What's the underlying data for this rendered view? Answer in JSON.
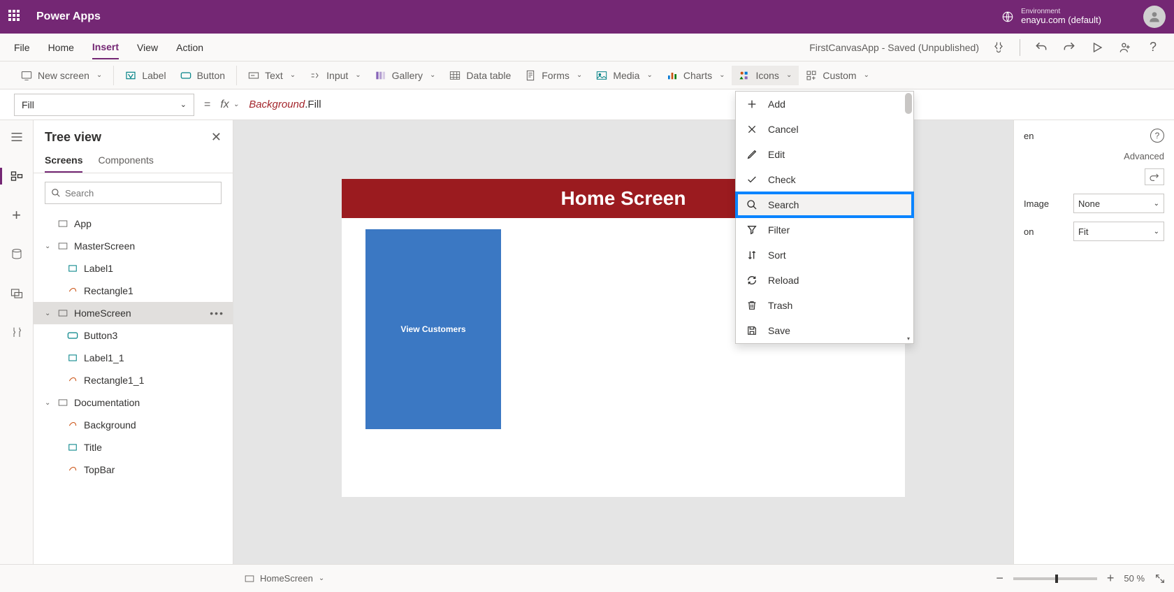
{
  "header": {
    "app_title": "Power Apps",
    "env_label": "Environment",
    "env_name": "enayu.com (default)"
  },
  "menubar": {
    "items": [
      "File",
      "Home",
      "Insert",
      "View",
      "Action"
    ],
    "active": "Insert",
    "doc_status": "FirstCanvasApp - Saved (Unpublished)"
  },
  "ribbon": {
    "new_screen": "New screen",
    "label": "Label",
    "button": "Button",
    "text": "Text",
    "input": "Input",
    "gallery": "Gallery",
    "data_table": "Data table",
    "forms": "Forms",
    "media": "Media",
    "charts": "Charts",
    "icons": "Icons",
    "custom": "Custom"
  },
  "formula": {
    "property": "Fill",
    "object": "Background",
    "suffix": ".Fill"
  },
  "tree": {
    "title": "Tree view",
    "tabs": [
      "Screens",
      "Components"
    ],
    "active_tab": "Screens",
    "search_placeholder": "Search",
    "nodes": {
      "app": "App",
      "master": "MasterScreen",
      "label1": "Label1",
      "rect1": "Rectangle1",
      "home": "HomeScreen",
      "button3": "Button3",
      "label11": "Label1_1",
      "rect11": "Rectangle1_1",
      "doc": "Documentation",
      "bg": "Background",
      "titlelbl": "Title",
      "topbar": "TopBar"
    }
  },
  "canvas": {
    "header": "Home Screen",
    "card": "View Customers"
  },
  "icons_menu": {
    "items": [
      {
        "label": "Add",
        "icon": "plus"
      },
      {
        "label": "Cancel",
        "icon": "x"
      },
      {
        "label": "Edit",
        "icon": "pencil"
      },
      {
        "label": "Check",
        "icon": "check"
      },
      {
        "label": "Search",
        "icon": "search",
        "highlight": true
      },
      {
        "label": "Filter",
        "icon": "filter"
      },
      {
        "label": "Sort",
        "icon": "sort"
      },
      {
        "label": "Reload",
        "icon": "reload"
      },
      {
        "label": "Trash",
        "icon": "trash"
      },
      {
        "label": "Save",
        "icon": "save"
      }
    ]
  },
  "props": {
    "tab": "Advanced",
    "label_partial1": "en",
    "image_label": "Image",
    "image_value": "None",
    "position_label": "on",
    "position_value": "Fit"
  },
  "status": {
    "screen_name": "HomeScreen",
    "zoom": "50",
    "zoom_unit": "%"
  }
}
